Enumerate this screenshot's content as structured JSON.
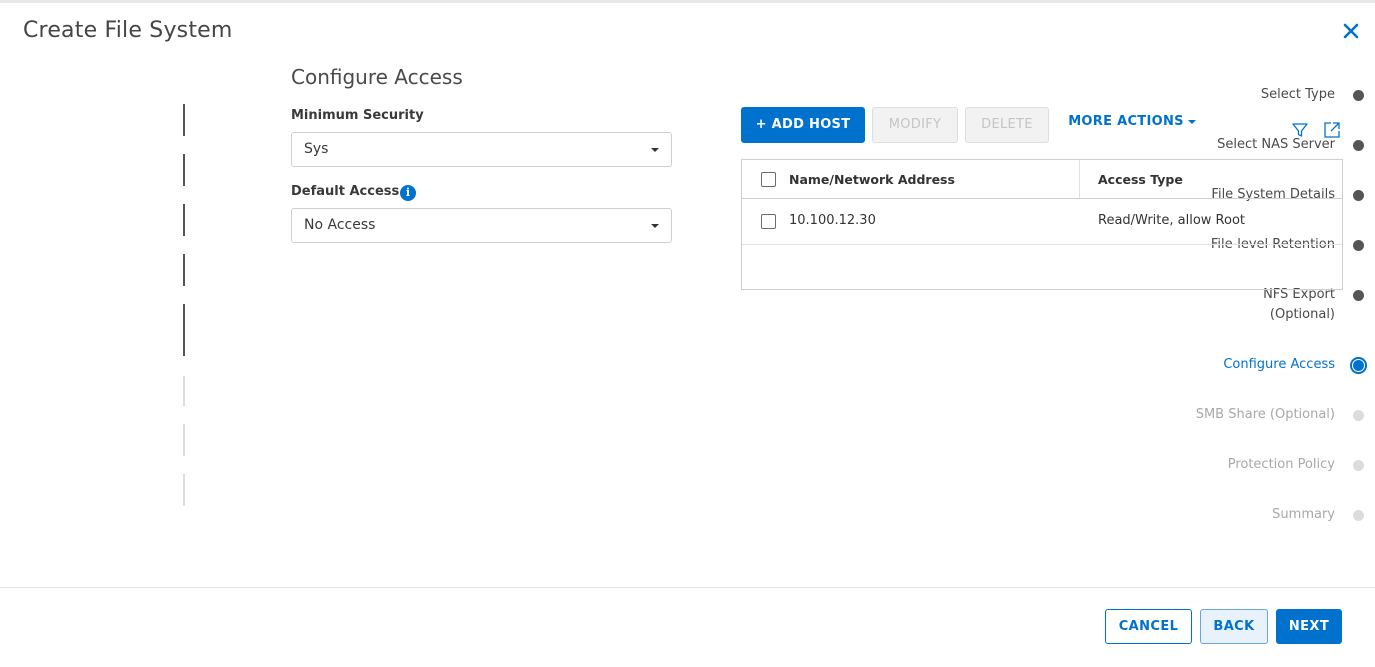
{
  "dialog": {
    "title": "Create File System",
    "close_icon": "close-icon"
  },
  "stepper": {
    "steps": [
      {
        "label": "Select Type",
        "state": "done"
      },
      {
        "label": "Select NAS Server",
        "state": "done"
      },
      {
        "label": "File System Details",
        "state": "done"
      },
      {
        "label": "File-level Retention",
        "state": "done"
      },
      {
        "label": "NFS Export",
        "label_line2": "(Optional)",
        "state": "done"
      },
      {
        "label": "Configure Access",
        "state": "current"
      },
      {
        "label": "SMB Share (Optional)",
        "state": "future"
      },
      {
        "label": "Protection Policy",
        "state": "future"
      },
      {
        "label": "Summary",
        "state": "future"
      }
    ]
  },
  "main": {
    "section_title": "Configure Access",
    "minimum_security": {
      "label": "Minimum Security",
      "value": "Sys"
    },
    "default_access": {
      "label": "Default Access",
      "info_icon": "i",
      "value": "No Access"
    }
  },
  "toolbar": {
    "add_host_label": "+ ADD HOST",
    "modify_label": "MODIFY",
    "delete_label": "DELETE",
    "more_actions_label": "MORE ACTIONS",
    "filter_icon": "filter-icon",
    "export_icon": "external-link-icon"
  },
  "hosts_table": {
    "columns": [
      "Name/Network Address",
      "Access Type"
    ],
    "rows": [
      {
        "address": "10.100.12.30",
        "access_type": "Read/Write, allow Root",
        "checked": false
      }
    ]
  },
  "footer": {
    "cancel_label": "CANCEL",
    "back_label": "BACK",
    "next_label": "NEXT"
  },
  "colors": {
    "accent": "#0072ce",
    "done_step": "#555555",
    "future_step": "#dcdcdc"
  }
}
